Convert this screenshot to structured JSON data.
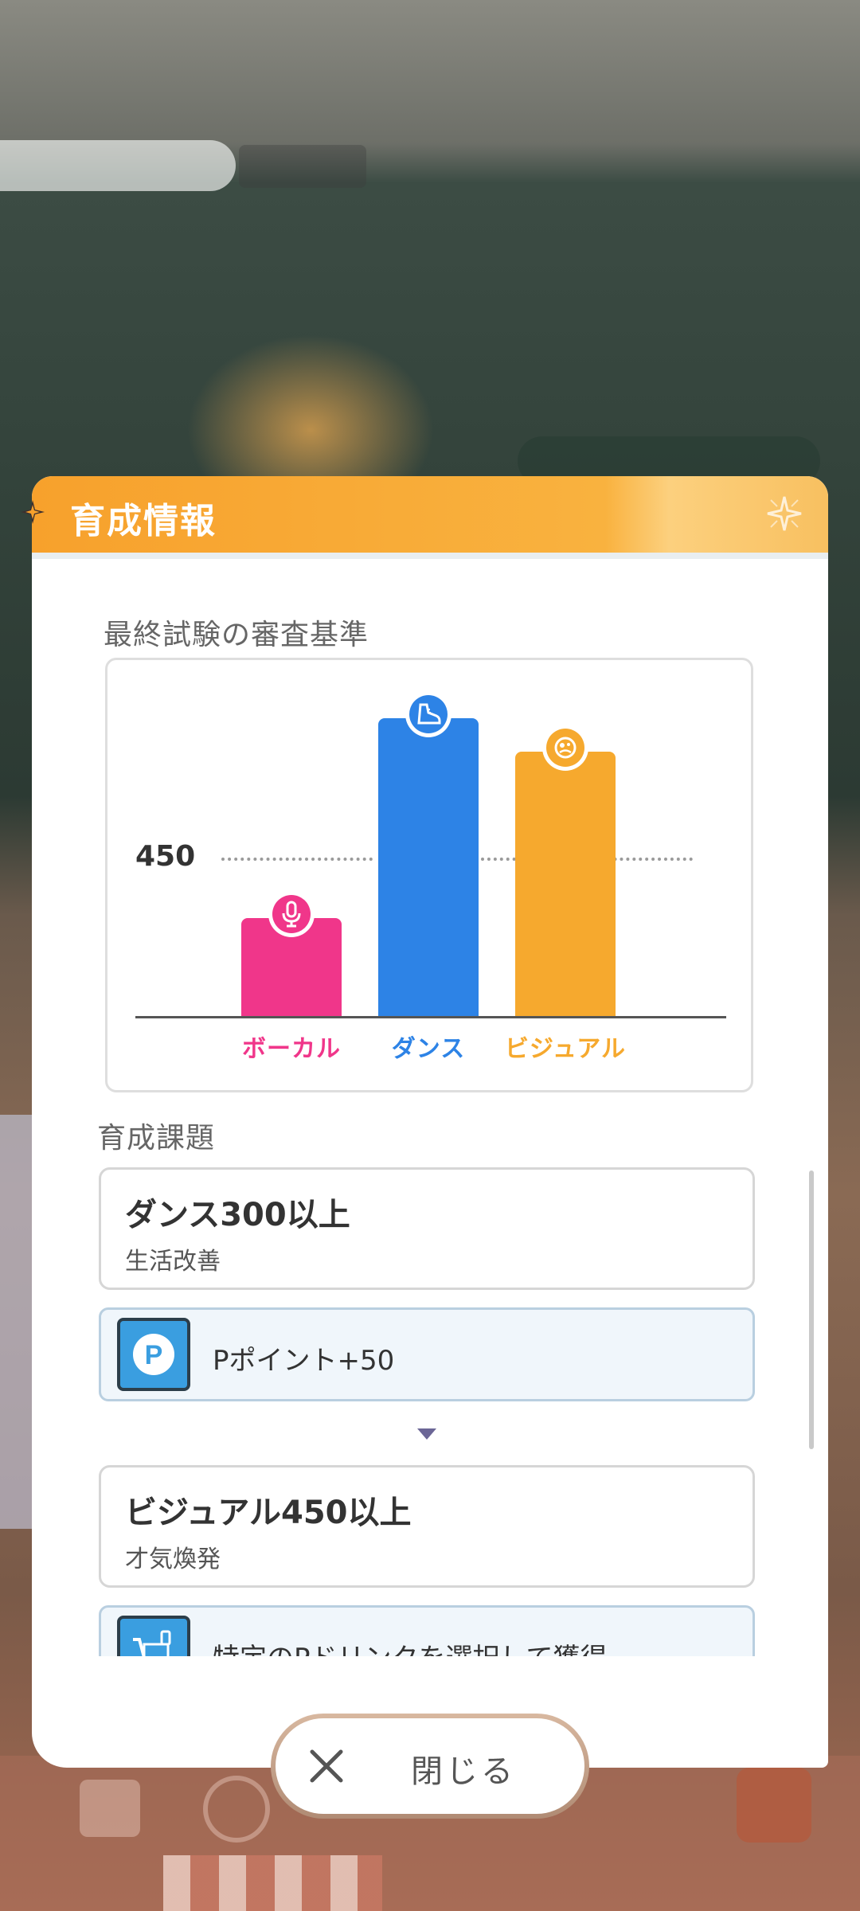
{
  "background": {
    "note_colors": [
      "#33433b",
      "#a66a52"
    ]
  },
  "modal": {
    "title": "育成情報",
    "criteria_label": "最終試験の審査基準",
    "tasks_label": "育成課題",
    "close_label": "閉じる"
  },
  "chart_data": {
    "type": "bar",
    "categories": [
      "ボーカル",
      "ダンス",
      "ビジュアル"
    ],
    "values": [
      130,
      395,
      350
    ],
    "colors": [
      "#f0368a",
      "#2d83e6",
      "#f6a92e"
    ],
    "threshold": {
      "label": "450",
      "value": 210
    },
    "icons": [
      "microphone-icon",
      "shoe-icon",
      "visual-icon"
    ],
    "ylim": [
      0,
      420
    ]
  },
  "tasks": [
    {
      "title": "ダンス300以上",
      "subtitle": "生活改善",
      "reward": {
        "icon": "p-point-icon",
        "text": "Pポイント+50"
      }
    },
    {
      "title": "ビジュアル450以上",
      "subtitle": "才気煥発",
      "reward": {
        "icon": "drink-cart-icon",
        "text": "特定のPドリンクを選択して獲得"
      }
    }
  ]
}
